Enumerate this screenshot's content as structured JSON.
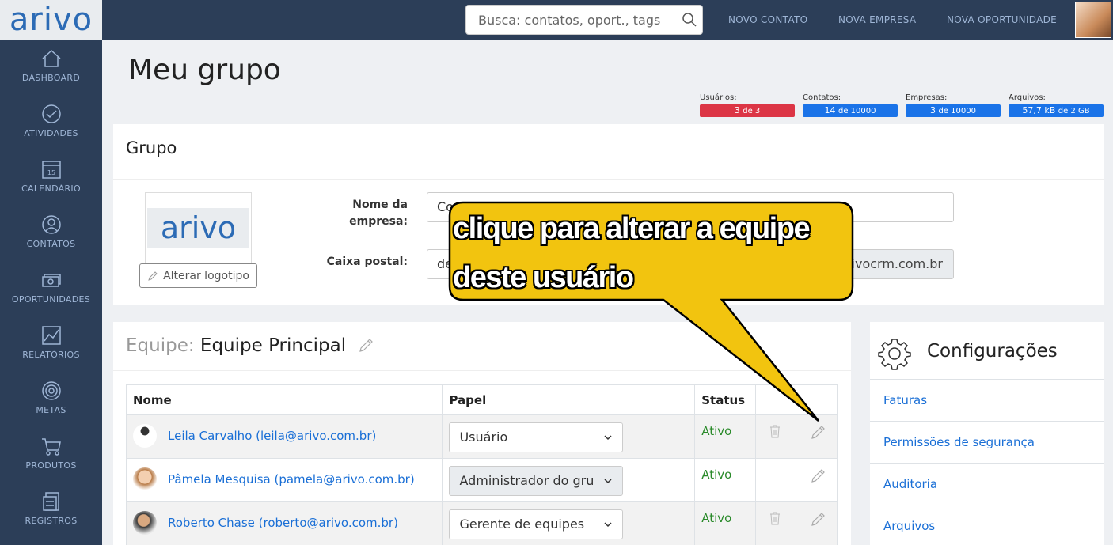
{
  "app": {
    "logo": "arivo"
  },
  "header": {
    "search_placeholder": "Busca: contatos, oport., tags",
    "links": [
      "NOVO CONTATO",
      "NOVA EMPRESA",
      "NOVA OPORTUNIDADE"
    ]
  },
  "sidebar": {
    "items": [
      {
        "label": "DASHBOARD",
        "icon": "home-icon"
      },
      {
        "label": "ATIVIDADES",
        "icon": "check-circle-icon"
      },
      {
        "label": "CALENDÁRIO",
        "icon": "calendar-icon"
      },
      {
        "label": "CONTATOS",
        "icon": "person-icon"
      },
      {
        "label": "OPORTUNIDADES",
        "icon": "money-icon"
      },
      {
        "label": "RELATÓRIOS",
        "icon": "chart-icon"
      },
      {
        "label": "METAS",
        "icon": "target-icon"
      },
      {
        "label": "PRODUTOS",
        "icon": "cart-icon"
      },
      {
        "label": "REGISTROS",
        "icon": "records-icon"
      }
    ]
  },
  "page": {
    "title": "Meu grupo"
  },
  "stats": [
    {
      "label": "Usuários:",
      "value": "3",
      "of": "de 3",
      "color": "#dc3545"
    },
    {
      "label": "Contatos:",
      "value": "14",
      "of": "de 10000",
      "color": "#1a73e8"
    },
    {
      "label": "Empresas:",
      "value": "3",
      "of": "de 10000",
      "color": "#1a73e8"
    },
    {
      "label": "Arquivos:",
      "value": "57,7 kB",
      "of": "de 2 GB",
      "color": "#1a73e8"
    }
  ],
  "group": {
    "title": "Grupo",
    "logo_text": "arivo",
    "change_logo": "Alterar logotipo",
    "company_label_1": "Nome da",
    "company_label_2": "empresa:",
    "company_value": "Co",
    "mailbox_label": "Caixa postal:",
    "mailbox_value": "de",
    "mailbox_suffix": "ivocrm.com.br"
  },
  "team": {
    "prefix": "Equipe:",
    "name": "Equipe Principal",
    "columns": [
      "Nome",
      "Papel",
      "Status",
      ""
    ],
    "rows": [
      {
        "user": "Leila Carvalho (leila@arivo.com.br)",
        "role": "Usuário",
        "status": "Ativo",
        "deletable": true
      },
      {
        "user": "Pâmela Mesquisa (pamela@arivo.com.br)",
        "role": "Administrador do gru",
        "status": "Ativo",
        "deletable": false
      },
      {
        "user": "Roberto Chase (roberto@arivo.com.br)",
        "role": "Gerente de equipes",
        "status": "Ativo",
        "deletable": true
      }
    ]
  },
  "config": {
    "title": "Configurações",
    "links": [
      "Faturas",
      "Permissões de segurança",
      "Auditoria",
      "Arquivos"
    ]
  },
  "callout": {
    "line1": "clique para alterar a equipe",
    "line2": "deste usuário",
    "color": "#f2c40f"
  }
}
